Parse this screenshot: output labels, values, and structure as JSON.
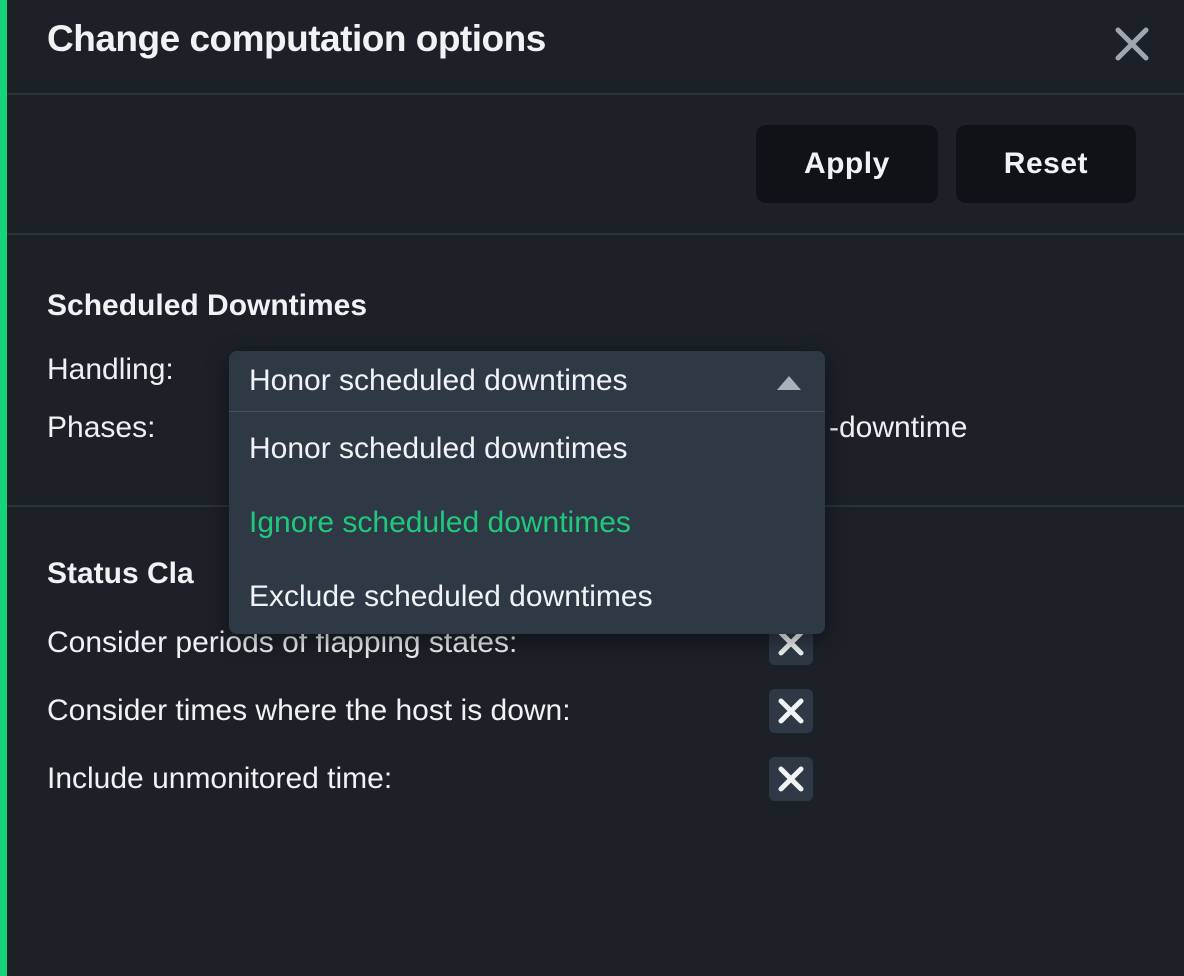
{
  "header": {
    "title": "Change computation options"
  },
  "actions": {
    "apply": "Apply",
    "reset": "Reset"
  },
  "downtimes": {
    "title": "Scheduled Downtimes",
    "handling_label": "Handling:",
    "phases_label": "Phases:",
    "phases_value_suffix": "-downtime",
    "dropdown": {
      "selected": "Honor scheduled downtimes",
      "options": [
        {
          "label": "Honor scheduled downtimes",
          "highlight": false
        },
        {
          "label": "Ignore scheduled downtimes",
          "highlight": true
        },
        {
          "label": "Exclude scheduled downtimes",
          "highlight": false
        }
      ]
    }
  },
  "status": {
    "title_prefix": "Status Cla",
    "rows": [
      {
        "label": "Consider periods of flapping states:"
      },
      {
        "label": "Consider times where the host is down:"
      },
      {
        "label": "Include unmonitored time:"
      }
    ]
  }
}
